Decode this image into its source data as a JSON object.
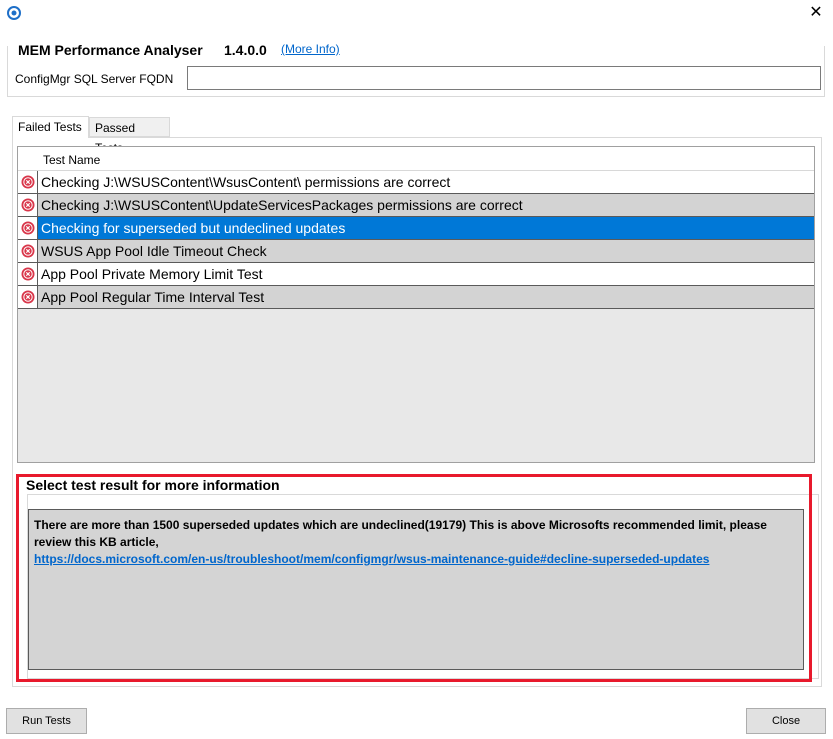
{
  "window": {
    "close_glyph": "✕",
    "app_icon": "gear-refresh-icon"
  },
  "header": {
    "title": "MEM Performance Analyser",
    "version": "1.4.0.0",
    "more_info": "(More Info)",
    "fqdn_label": "ConfigMgr SQL Server FQDN",
    "fqdn_value": ""
  },
  "tabs": [
    {
      "label": "Failed Tests",
      "selected": true
    },
    {
      "label": "Passed Tests",
      "selected": false
    }
  ],
  "grid": {
    "column": "Test Name",
    "rows": [
      {
        "name": "Checking J:\\WSUSContent\\WsusContent\\ permissions are correct",
        "status": "error"
      },
      {
        "name": "Checking J:\\WSUSContent\\UpdateServicesPackages permissions are correct",
        "status": "error"
      },
      {
        "name": "Checking for superseded but undeclined updates",
        "status": "error"
      },
      {
        "name": "WSUS App Pool Idle Timeout Check",
        "status": "error"
      },
      {
        "name": "App Pool Private Memory Limit Test",
        "status": "error"
      },
      {
        "name": "App Pool Regular Time Interval Test",
        "status": "error"
      }
    ]
  },
  "info": {
    "title": "Select test result for more information",
    "text": "There are more than 1500 superseded updates which are undeclined(19179) This is above Microsofts recommended limit, please review this KB article,",
    "link": "https://docs.microsoft.com/en-us/troubleshoot/mem/configmgr/wsus-maintenance-guide#decline-superseded-updates"
  },
  "buttons": {
    "run_tests": "Run Tests",
    "close": "Close"
  },
  "colors": {
    "selection": "#0078d7",
    "row_alt": "#d3d3d3",
    "error_icon": "#d9364a",
    "highlight_frame": "#e8192c",
    "link": "#0066cc"
  }
}
